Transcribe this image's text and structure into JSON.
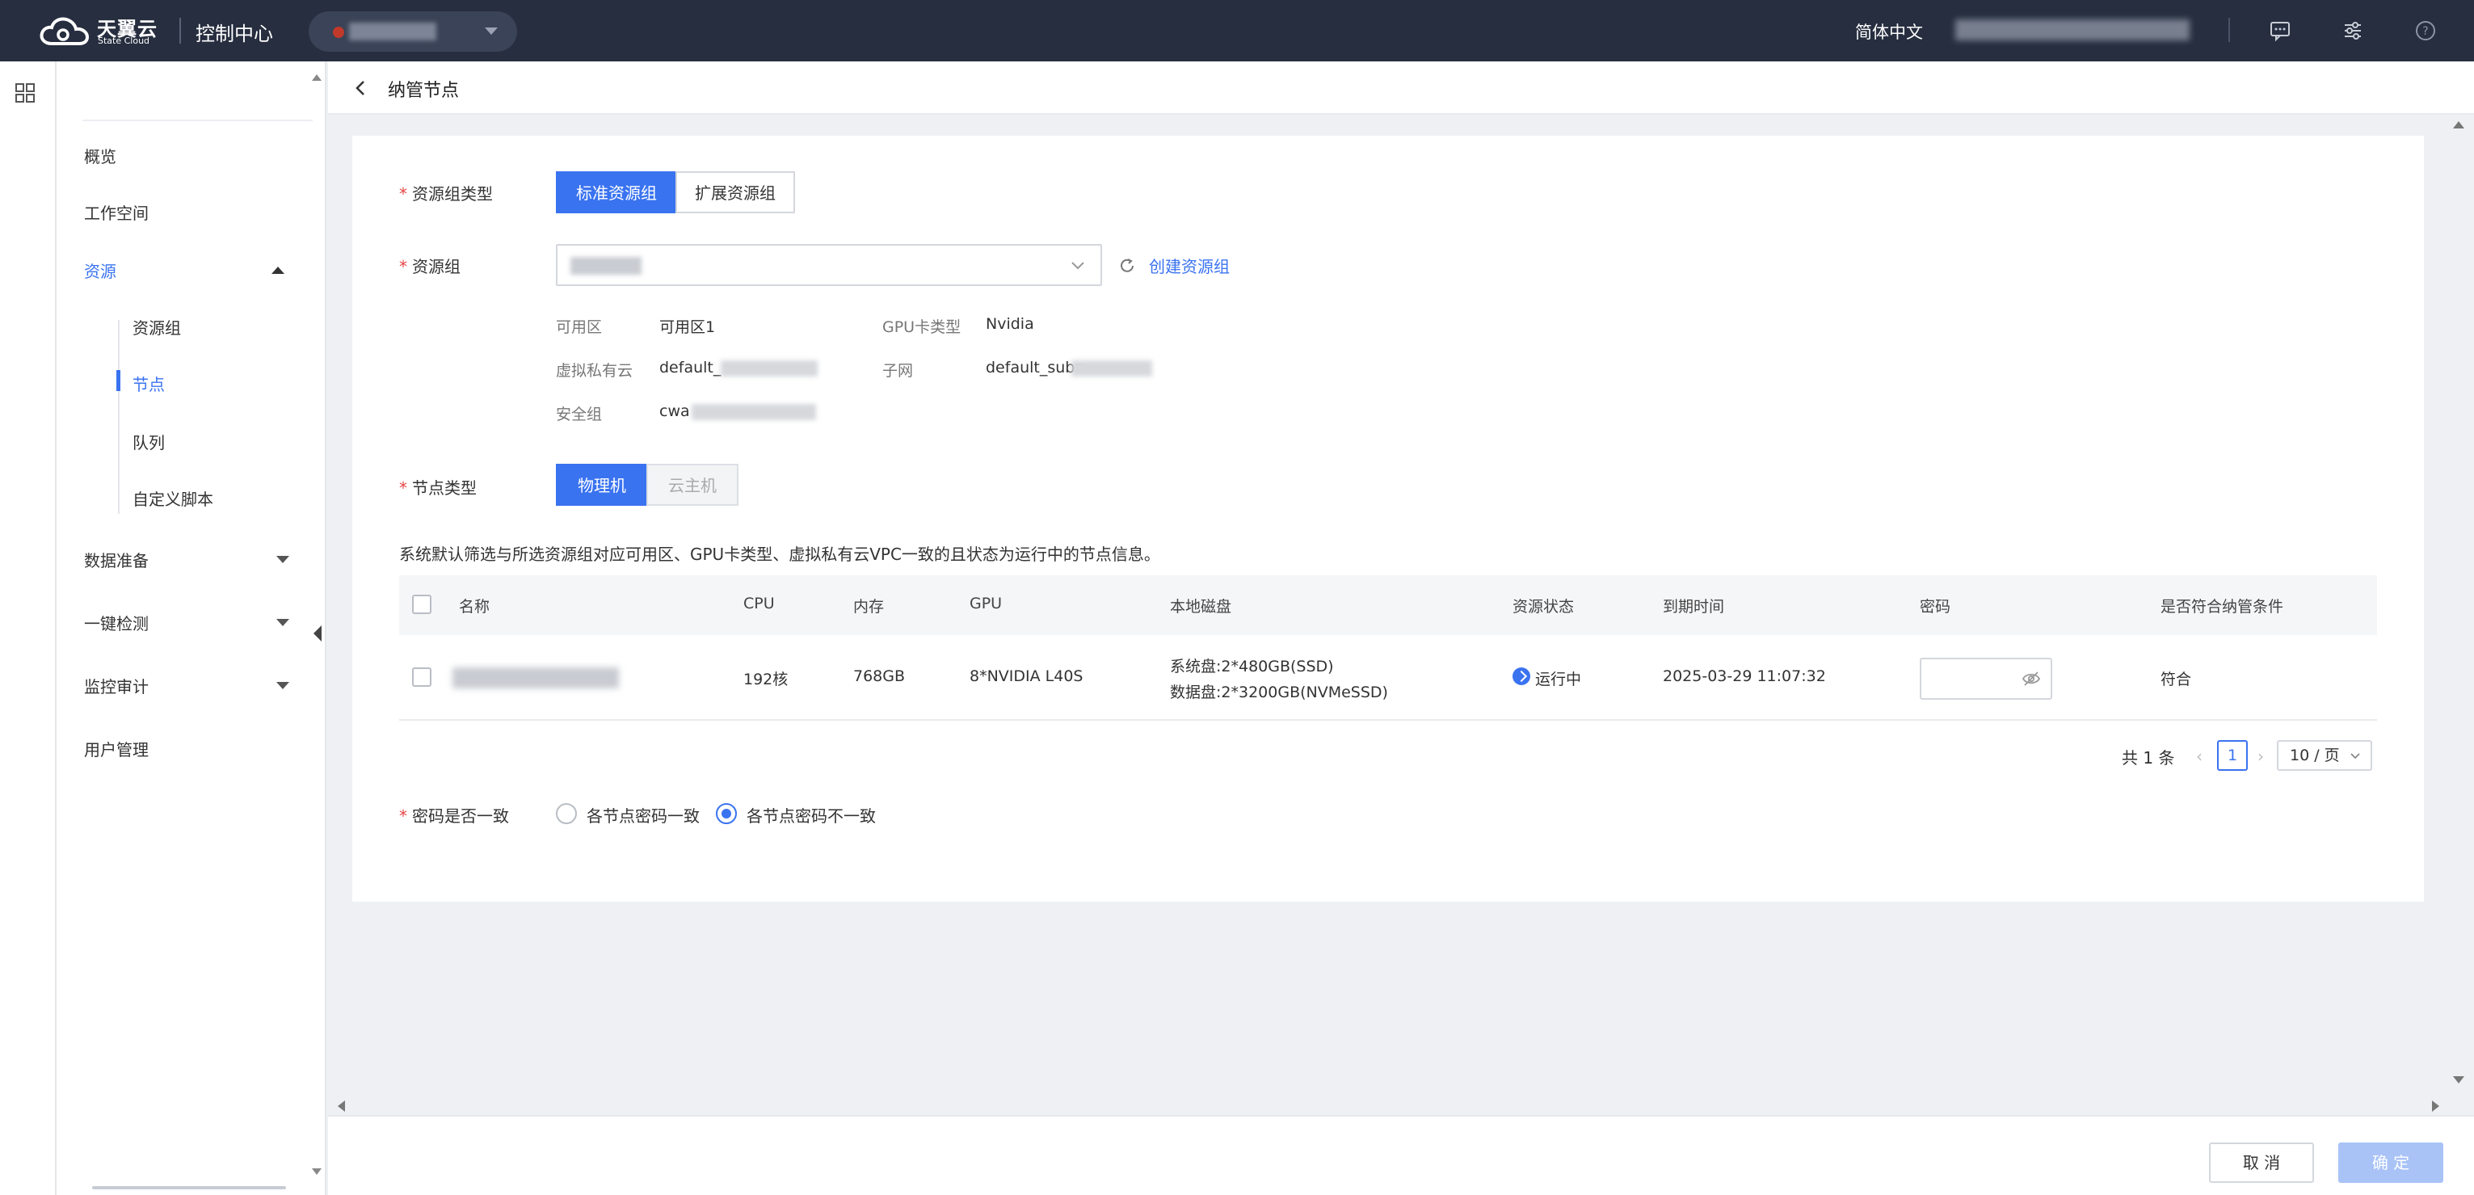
{
  "topbar": {
    "logo_cn": "天翼云",
    "logo_en": "State Cloud",
    "console_title": "控制中心",
    "language": "简体中文",
    "icons": [
      "message-icon",
      "settings-sliders-icon",
      "help-icon"
    ]
  },
  "sidebar": {
    "items": [
      {
        "label": "概览"
      },
      {
        "label": "工作空间"
      },
      {
        "label": "资源",
        "expanded": true,
        "active": true
      },
      {
        "label": "数据准备"
      },
      {
        "label": "一键检测"
      },
      {
        "label": "监控审计"
      },
      {
        "label": "用户管理"
      }
    ],
    "sub_items": [
      {
        "label": "资源组"
      },
      {
        "label": "节点",
        "active": true
      },
      {
        "label": "队列"
      },
      {
        "label": "自定义脚本"
      }
    ]
  },
  "header": {
    "title": "纳管节点"
  },
  "form": {
    "group_type_label": "资源组类型",
    "group_type_options": [
      "标准资源组",
      "扩展资源组"
    ],
    "group_type_selected": "标准资源组",
    "group_label": "资源组",
    "create_group_link": "创建资源组",
    "info": {
      "zone_key": "可用区",
      "zone_val": "可用区1",
      "gpu_key": "GPU卡类型",
      "gpu_val": "Nvidia",
      "vpc_key": "虚拟私有云",
      "vpc_val": "default_",
      "subnet_key": "子网",
      "subnet_val": "default_subr",
      "sg_key": "安全组",
      "sg_val": "cwa"
    },
    "node_type_label": "节点类型",
    "node_type_options": [
      "物理机",
      "云主机"
    ],
    "node_type_selected": "物理机",
    "hint": "系统默认筛选与所选资源组对应可用区、GPU卡类型、虚拟私有云VPC一致的且状态为运行中的节点信息。",
    "password_label": "密码是否一致",
    "password_options": [
      "各节点密码一致",
      "各节点密码不一致"
    ],
    "password_selected": "各节点密码不一致"
  },
  "table": {
    "columns": [
      "名称",
      "CPU",
      "内存",
      "GPU",
      "本地磁盘",
      "资源状态",
      "到期时间",
      "密码",
      "是否符合纳管条件"
    ],
    "rows": [
      {
        "cpu": "192核",
        "memory": "768GB",
        "gpu": "8*NVIDIA L40S",
        "disk_sys": "系统盘:2*480GB(SSD)",
        "disk_data": "数据盘:2*3200GB(NVMeSSD)",
        "status": "运行中",
        "expire": "2025-03-29 11:07:32",
        "eligible": "符合"
      }
    ]
  },
  "pagination": {
    "total": "共 1 条",
    "current": "1",
    "page_size": "10 / 页"
  },
  "footer": {
    "cancel": "取 消",
    "confirm": "确 定"
  },
  "colors": {
    "primary": "#3a73f0",
    "topbar": "#262e3f",
    "required": "#e54545"
  }
}
